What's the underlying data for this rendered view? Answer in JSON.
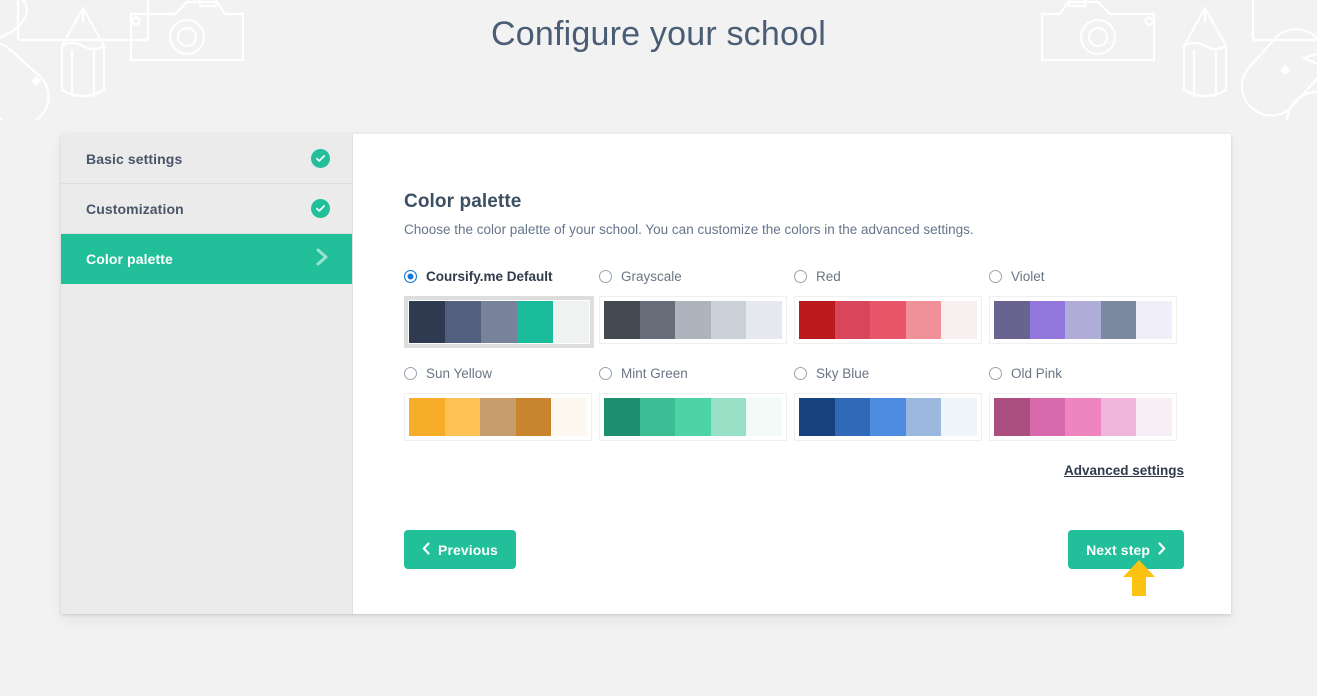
{
  "header": {
    "title": "Configure your school"
  },
  "sidebar": {
    "items": [
      {
        "label": "Basic settings",
        "state": "complete",
        "icon": "check-circle-icon"
      },
      {
        "label": "Customization",
        "state": "complete",
        "icon": "check-circle-icon"
      },
      {
        "label": "Color palette",
        "state": "active",
        "icon": "chevron-right-icon"
      }
    ]
  },
  "main": {
    "section_title": "Color palette",
    "section_description": "Choose the color palette of your school. You can customize the colors in the advanced settings.",
    "advanced_settings_label": "Advanced settings",
    "selected_palette": "Coursify.me Default",
    "palettes": [
      {
        "label": "Coursify.me Default",
        "selected": true,
        "colors": [
          "#2f3950",
          "#525f7f",
          "#78829b",
          "#1abc9c",
          "#f0f1f1"
        ]
      },
      {
        "label": "Grayscale",
        "selected": false,
        "colors": [
          "#454952",
          "#666c78",
          "#aeb4be",
          "#ccd1d9",
          "#e5e8ec"
        ]
      },
      {
        "label": "Red",
        "selected": false,
        "colors": [
          "#bb1b1b",
          "#d9455a",
          "#e9566a",
          "#f09098",
          "#f6f0ef"
        ]
      },
      {
        "label": "Violet",
        "selected": false,
        "colors": [
          "#67648f",
          "#9277dc",
          "#b0add8",
          "#7c889f",
          "#f0eefb"
        ]
      },
      {
        "label": "Sun Yellow",
        "selected": false,
        "colors": [
          "#f7ad29",
          "#ffc155",
          "#c79e6b",
          "#c9842e",
          "#fef9f0"
        ]
      },
      {
        "label": "Mint Green",
        "selected": false,
        "colors": [
          "#1d8f6f",
          "#3dbd93",
          "#4dd3a6",
          "#97e0c6",
          "#f2fbf8"
        ]
      },
      {
        "label": "Sky Blue",
        "selected": false,
        "colors": [
          "#17427d",
          "#3069b7",
          "#4d8ce0",
          "#9bb9de",
          "#f0f5f9"
        ]
      },
      {
        "label": "Old Pink",
        "selected": false,
        "colors": [
          "#ab4f80",
          "#d76aac",
          "#ee85c0",
          "#f0b6dc",
          "#f8eef5"
        ]
      }
    ]
  },
  "footer": {
    "previous_label": "Previous",
    "next_label": "Next step"
  },
  "colors": {
    "accent": "#21bf9a",
    "radio_selected": "#1477d4",
    "title": "#4a5d75",
    "page_background": "#f2f2f2",
    "annotation_arrow": "#fcc313"
  }
}
